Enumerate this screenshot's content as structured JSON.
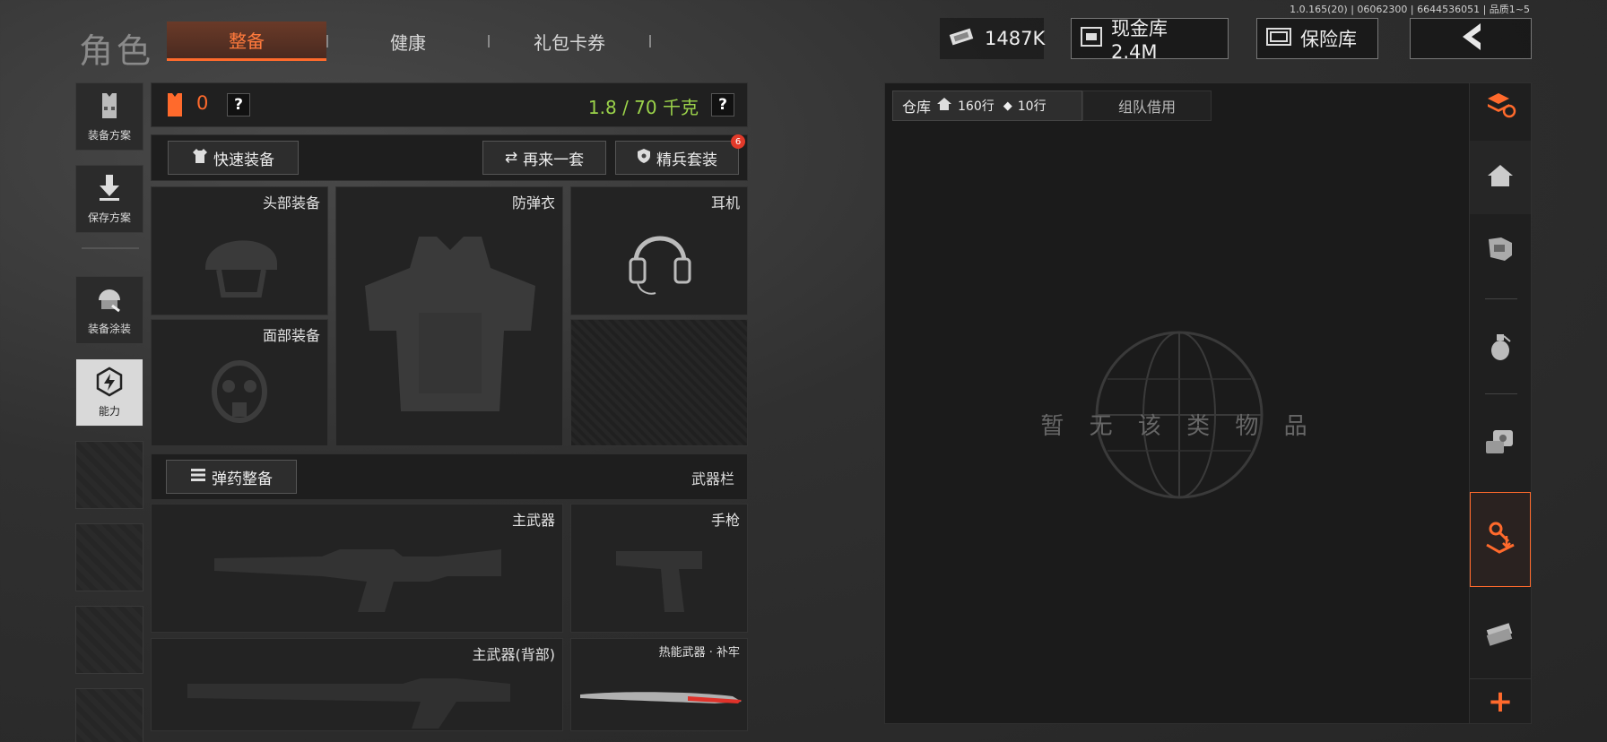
{
  "version": "1.0.165(20) | 06062300 | 6644536051 | 品质1~5",
  "title": "角色",
  "tabs": [
    {
      "label": "整备",
      "active": true
    },
    {
      "label": "健康",
      "active": false
    },
    {
      "label": "礼包卡券",
      "active": false
    }
  ],
  "topbar": {
    "cash": "1487K",
    "vault": "现金库 2.4M",
    "safe": "保险库"
  },
  "left_rail": [
    {
      "label": "装备方案",
      "icon": "vest-icon"
    },
    {
      "label": "保存方案",
      "icon": "download-icon"
    },
    {
      "label": "装备涂装",
      "icon": "helmet-skin-icon"
    },
    {
      "label": "能力",
      "icon": "ability-icon",
      "active": true
    }
  ],
  "loadout": {
    "armor_count": "0",
    "weight": "1.8 / 70 千克",
    "help": "?",
    "quick_equip": "快速装备",
    "again": "再来一套",
    "elite": "精兵套装",
    "elite_badge": "6",
    "slots": {
      "head": "头部装备",
      "vest": "防弹衣",
      "headset": "耳机",
      "face": "面部装备",
      "primary": "主武器",
      "pistol": "手枪",
      "primary_back": "主武器(背部)",
      "melee": "热能武器 · 补牢"
    },
    "ammo": "弹药整备",
    "weapon_bar": "武器栏"
  },
  "storage": {
    "tab_label": "仓库",
    "rows": "160行",
    "rows2": "10行",
    "team": "组队借用",
    "empty": "暂 无 该 类 物 品"
  },
  "colors": {
    "accent": "#ff6a2c",
    "green": "#9bd34a"
  }
}
